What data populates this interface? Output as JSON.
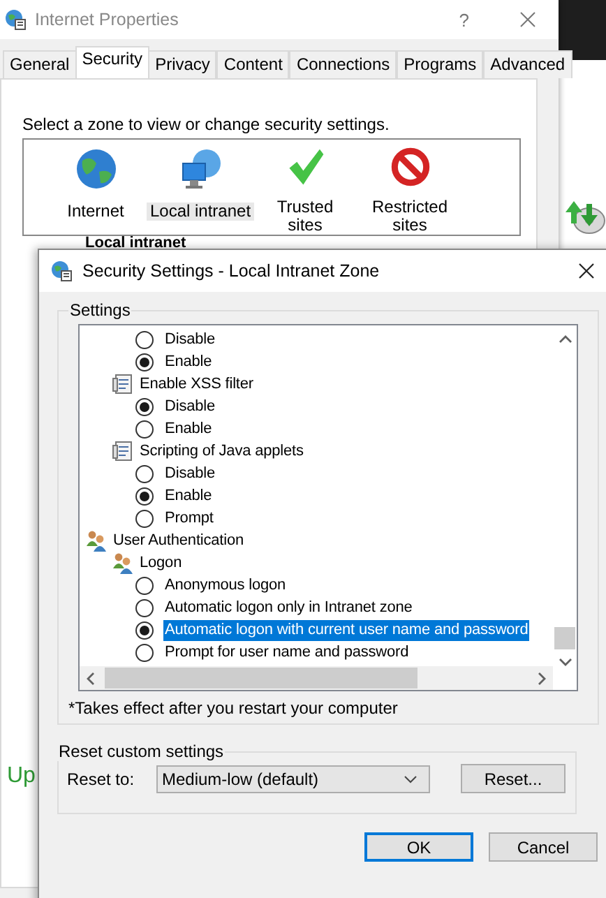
{
  "background_window": {
    "title": "Internet Properties",
    "help": "?",
    "tabs": [
      {
        "label": "General",
        "selected": false
      },
      {
        "label": "Security",
        "selected": true
      },
      {
        "label": "Privacy",
        "selected": false
      },
      {
        "label": "Content",
        "selected": false
      },
      {
        "label": "Connections",
        "selected": false
      },
      {
        "label": "Programs",
        "selected": false
      },
      {
        "label": "Advanced",
        "selected": false
      }
    ],
    "zone_prompt": "Select a zone to view or change security settings.",
    "zones": [
      {
        "kind": "internet",
        "label": "Internet",
        "selected": false
      },
      {
        "kind": "intranet",
        "label": "Local intranet",
        "selected": true
      },
      {
        "kind": "trusted",
        "label": "Trusted sites",
        "selected": false
      },
      {
        "kind": "restricted",
        "label": "Restricted sites",
        "selected": false
      }
    ],
    "zone_heading": "Local intranet",
    "side_text": "Up"
  },
  "dialog": {
    "title": "Security Settings - Local Intranet Zone",
    "settings_label": "Settings",
    "settings": [
      {
        "kind": "radio",
        "label": "Disable",
        "checked": false,
        "selected": false
      },
      {
        "kind": "radio",
        "label": "Enable",
        "checked": true,
        "selected": false
      },
      {
        "kind": "category",
        "label": "Enable XSS filter",
        "children": [
          {
            "kind": "radio",
            "label": "Disable",
            "checked": true,
            "selected": false
          },
          {
            "kind": "radio",
            "label": "Enable",
            "checked": false,
            "selected": false
          }
        ]
      },
      {
        "kind": "category",
        "label": "Scripting of Java applets",
        "children": [
          {
            "kind": "radio",
            "label": "Disable",
            "checked": false,
            "selected": false
          },
          {
            "kind": "radio",
            "label": "Enable",
            "checked": true,
            "selected": false
          },
          {
            "kind": "radio",
            "label": "Prompt",
            "checked": false,
            "selected": false
          }
        ]
      },
      {
        "kind": "group",
        "label": "User Authentication",
        "children": [
          {
            "kind": "subgroup",
            "label": "Logon",
            "children": [
              {
                "kind": "radio",
                "label": "Anonymous logon",
                "checked": false,
                "selected": false
              },
              {
                "kind": "radio",
                "label": "Automatic logon only in Intranet zone",
                "checked": false,
                "selected": false
              },
              {
                "kind": "radio",
                "label": "Automatic logon with current user name and password",
                "checked": true,
                "selected": true
              },
              {
                "kind": "radio",
                "label": "Prompt for user name and password",
                "checked": false,
                "selected": false
              }
            ]
          }
        ]
      }
    ],
    "footnote": "*Takes effect after you restart your computer",
    "reset_group": {
      "label": "Reset custom settings",
      "reset_to_label": "Reset to:",
      "value": "Medium-low (default)",
      "button": "Reset..."
    },
    "buttons": [
      {
        "label": "OK",
        "default": true
      },
      {
        "label": "Cancel",
        "default": false
      }
    ]
  }
}
